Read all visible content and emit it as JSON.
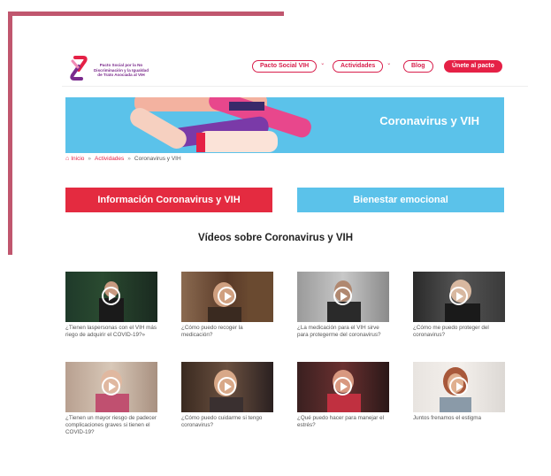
{
  "logo": {
    "text_line1": "Pacto Social por la No",
    "text_line2": "Discriminación y la Igualdad",
    "text_line3": "de Trato Asociada al VIH"
  },
  "nav": {
    "items": [
      {
        "label": "Pacto Social VIH",
        "has_caret": true
      },
      {
        "label": "Actividades",
        "has_caret": true
      },
      {
        "label": "Blog",
        "has_caret": false
      }
    ],
    "cta_label": "Únete al pacto"
  },
  "banner": {
    "title": "Coronavirus y VIH"
  },
  "breadcrumb": {
    "home_icon": "home-icon",
    "items": [
      "Inicio",
      "Actividades",
      "Coronavirus y VIH"
    ],
    "separator": "»"
  },
  "buttons": {
    "info": "Información Coronavirus y VIH",
    "bienestar": "Bienestar emocional"
  },
  "section_title": "Vídeos sobre Coronavirus y VIH",
  "videos": [
    {
      "caption": "¿Tienen laspersonas con el VIH más riego de adquirir el COVID-19?»"
    },
    {
      "caption": "¿Cómo puedo recoger la medicación?"
    },
    {
      "caption": "¿La medicación para el VIH sirve para protegerme del coronavirus?"
    },
    {
      "caption": "¿Cómo me puedo proteger del coronavirus?"
    },
    {
      "caption": "¿Tienen un mayor riesgo de padecer complicaciones graves si tienen el COVID-19?"
    },
    {
      "caption": "¿Cómo puedo cuidarme si tengo coronavirus?"
    },
    {
      "caption": "¿Qué puedo hacer para manejar el estrés?"
    },
    {
      "caption": "Juntos frenamos el estigma"
    }
  ],
  "colors": {
    "accent_red": "#e52146",
    "accent_blue": "#5bc2ea",
    "frame": "#c0566e"
  }
}
